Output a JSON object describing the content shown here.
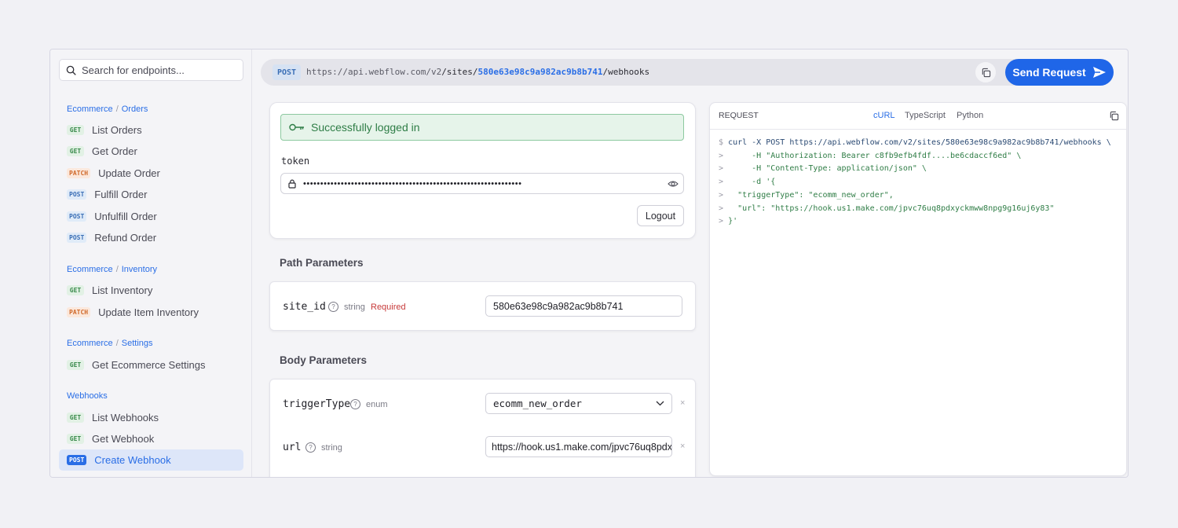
{
  "sidebar": {
    "search_placeholder": "Search for endpoints...",
    "groups": [
      {
        "parent": "Ecommerce",
        "child": "Orders"
      },
      {
        "parent": "Ecommerce",
        "child": "Inventory"
      },
      {
        "parent": "Ecommerce",
        "child": "Settings"
      },
      {
        "parent": "Webhooks",
        "child": ""
      }
    ],
    "separator": "/",
    "items": [
      {
        "method": "GET",
        "label": "List Orders"
      },
      {
        "method": "GET",
        "label": "Get Order"
      },
      {
        "method": "PATCH",
        "label": "Update Order"
      },
      {
        "method": "POST",
        "label": "Fulfill Order"
      },
      {
        "method": "POST",
        "label": "Unfulfill Order"
      },
      {
        "method": "POST",
        "label": "Refund Order"
      },
      {
        "method": "GET",
        "label": "List Inventory"
      },
      {
        "method": "PATCH",
        "label": "Update Item Inventory"
      },
      {
        "method": "GET",
        "label": "Get Ecommerce Settings"
      },
      {
        "method": "GET",
        "label": "List Webhooks"
      },
      {
        "method": "GET",
        "label": "Get Webhook"
      },
      {
        "method": "POST",
        "label": "Create Webhook",
        "active": true
      }
    ]
  },
  "urlbar": {
    "method": "POST",
    "base": "https://api.webflow.com/v2",
    "path1": "/sites/",
    "site_id": "580e63e98c9a982ac9b8b741",
    "path2": "/webhooks",
    "copy_icon": "copy-icon",
    "send_label": "Send Request"
  },
  "auth": {
    "success_text": "Successfully logged in",
    "token_label": "token",
    "token_value": "••••••••••••••••••••••••••••••••••••••••••••••••••••••••••••••••",
    "logout_label": "Logout"
  },
  "path_params": {
    "title": "Path Parameters",
    "params": [
      {
        "name": "site_id",
        "help": "?",
        "type": "string",
        "required": "Required",
        "value": "580e63e98c9a982ac9b8b741"
      }
    ]
  },
  "body_params": {
    "title": "Body Parameters",
    "params": [
      {
        "name": "triggerType",
        "help": "?",
        "type": "enum",
        "value": "ecomm_new_order",
        "clear": "×"
      },
      {
        "name": "url",
        "help": "?",
        "type": "string",
        "value": "https://hook.us1.make.com/jpvc76uq8pdxyckmww8npg9g16uj6y83",
        "clear": "×"
      }
    ]
  },
  "request_panel": {
    "label": "REQUEST",
    "tabs": [
      "cURL",
      "TypeScript",
      "Python"
    ],
    "selected_tab": "cURL",
    "prompts": [
      "$",
      ">",
      ">",
      ">",
      ">",
      ">",
      ">"
    ],
    "lines": [
      "curl -X POST https://api.webflow.com/v2/sites/580e63e98c9a982ac9b8b741/webhooks \\",
      "     -H \"Authorization: Bearer c8fb9efb4fdf....be6cdaccf6ed\" \\",
      "     -H \"Content-Type: application/json\" \\",
      "     -d '{",
      "  \"triggerType\": \"ecomm_new_order\",",
      "  \"url\": \"https://hook.us1.make.com/jpvc76uq8pdxyckmww8npg9g16uj6y83\"",
      "}'"
    ]
  },
  "colors": {
    "accent": "#1f66e8",
    "success_bg": "#e6f4ea",
    "success_text": "#2e7d46",
    "required": "#c73a3a"
  }
}
